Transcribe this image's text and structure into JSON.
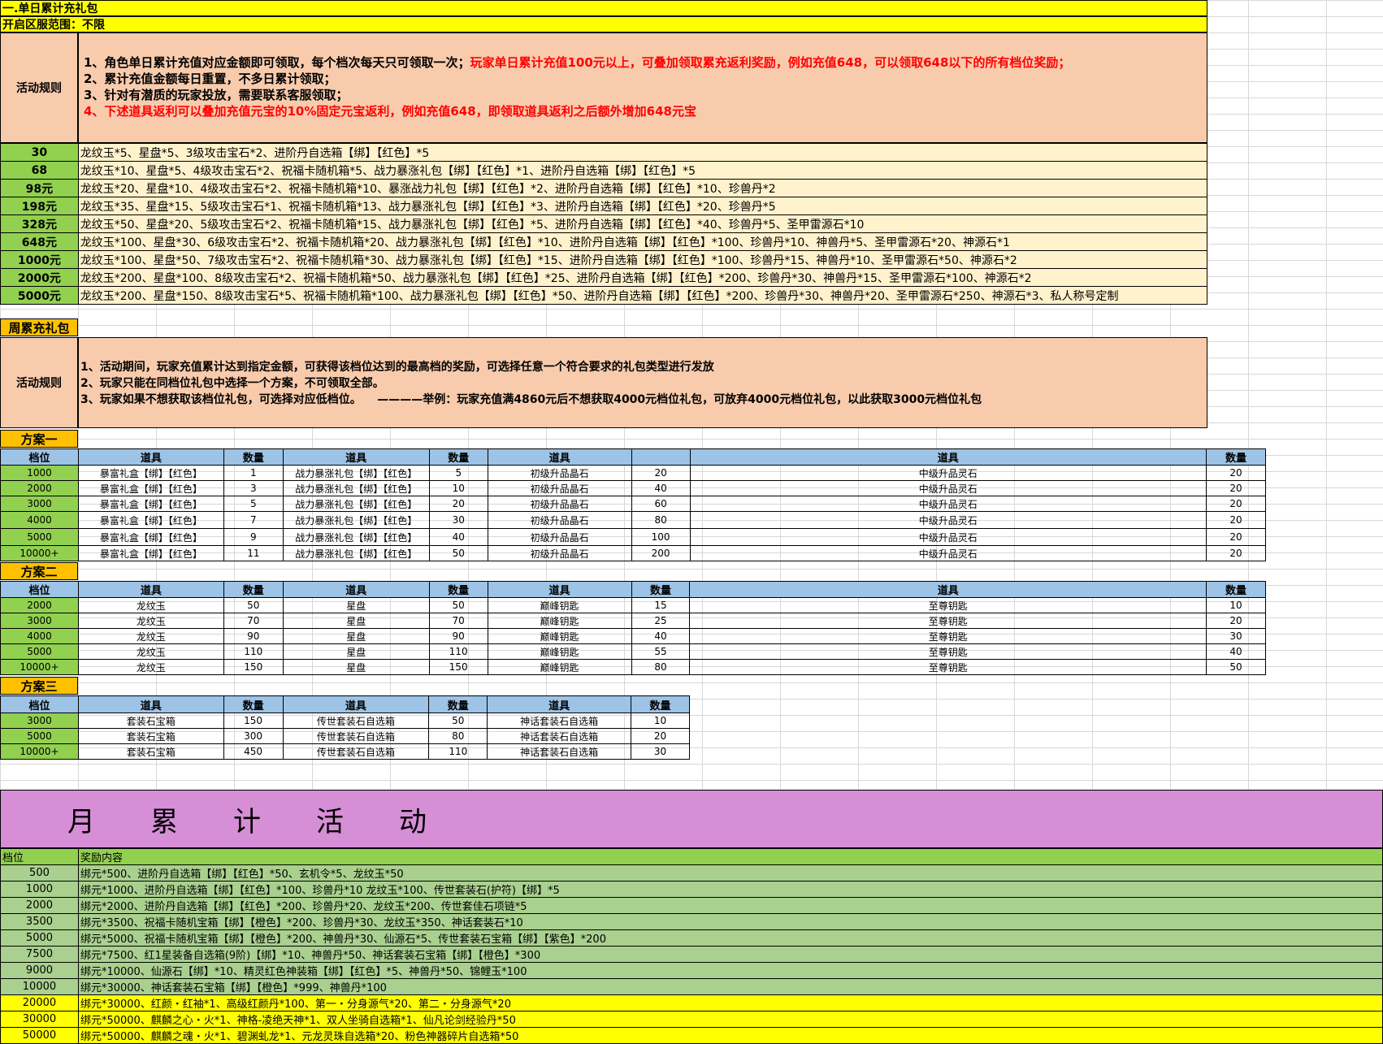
{
  "section1": {
    "title": "一.单日累计充礼包",
    "range": "开启区服范围：不限",
    "rules_label": "活动规则",
    "rules": [
      {
        "text": "1、角色单日累计充值对应金额即可领取，每个档次每天只可领取一次；",
        "red": "玩家单日累计充值100元以上，可叠加领取累充返利奖励，例如充值648，可以领取648以下的所有档位奖励；"
      },
      {
        "text": "2、累计充值金额每日重置，不多日累计领取；",
        "red": ""
      },
      {
        "text": "3、针对有潜质的玩家投放，需要联系客服领取；",
        "red": ""
      },
      {
        "text": "",
        "red": "4、下述道具返利可以叠加充值元宝的10%固定元宝返利，例如充值648，即领取道具返利之后额外增加648元宝"
      }
    ],
    "tiers": [
      {
        "level": "30",
        "reward": "龙纹玉*5、星盘*5、3级攻击宝石*2、进阶丹自选箱【绑】【红色】*5"
      },
      {
        "level": "68",
        "reward": "龙纹玉*10、星盘*5、4级攻击宝石*2、祝福卡随机箱*5、战力暴涨礼包【绑】【红色】*1、进阶丹自选箱【绑】【红色】*5"
      },
      {
        "level": "98元",
        "reward": "龙纹玉*20、星盘*10、4级攻击宝石*2、祝福卡随机箱*10、暴涨战力礼包【绑】【红色】*2、进阶丹自选箱【绑】【红色】*10、珍兽丹*2"
      },
      {
        "level": "198元",
        "reward": "龙纹玉*35、星盘*15、5级攻击宝石*1、祝福卡随机箱*13、战力暴涨礼包【绑】【红色】*3、进阶丹自选箱【绑】【红色】*20、珍兽丹*5"
      },
      {
        "level": "328元",
        "reward": "龙纹玉*50、星盘*20、5级攻击宝石*2、祝福卡随机箱*15、战力暴涨礼包【绑】【红色】*5、进阶丹自选箱【绑】【红色】*40、珍兽丹*5、圣甲雷源石*10"
      },
      {
        "level": "648元",
        "reward": "龙纹玉*100、星盘*30、6级攻击宝石*2、祝福卡随机箱*20、战力暴涨礼包【绑】【红色】*10、进阶丹自选箱【绑】【红色】*100、珍兽丹*10、神兽丹*5、圣甲雷源石*20、神源石*1"
      },
      {
        "level": "1000元",
        "reward": "龙纹玉*100、星盘*50、7级攻击宝石*2、祝福卡随机箱*30、战力暴涨礼包【绑】【红色】*15、进阶丹自选箱【绑】【红色】*100、珍兽丹*15、神兽丹*10、圣甲雷源石*50、神源石*2"
      },
      {
        "level": "2000元",
        "reward": "龙纹玉*200、星盘*100、8级攻击宝石*2、祝福卡随机箱*50、战力暴涨礼包【绑】【红色】*25、进阶丹自选箱【绑】【红色】*200、珍兽丹*30、神兽丹*15、圣甲雷源石*100、神源石*2"
      },
      {
        "level": "5000元",
        "reward": "龙纹玉*200、星盘*150、8级攻击宝石*5、祝福卡随机箱*100、战力暴涨礼包【绑】【红色】*50、进阶丹自选箱【绑】【红色】*200、珍兽丹*30、神兽丹*20、圣甲雷源石*250、神源石*3、私人称号定制"
      }
    ]
  },
  "section2": {
    "title": "周累充礼包",
    "rules_label": "活动规则",
    "rules": [
      "1、活动期间，玩家充值累计达到指定金额，可获得该档位达到的最高档的奖励，可选择任意一个符合要求的礼包类型进行发放",
      "2、玩家只能在同档位礼包中选择一个方案，不可领取全部。",
      "3、玩家如果不想获取该档位礼包，可选择对应低档位。    ————举例：玩家充值满4860元后不想获取4000元档位礼包，可放弃4000元档位礼包，以此获取3000元档位礼包"
    ],
    "plan1": {
      "title": "方案一",
      "headers": [
        "档位",
        "道具",
        "数量",
        "道具",
        "数量",
        "道具",
        "",
        "道具",
        "数量"
      ],
      "rows": [
        [
          "1000",
          "暴富礼盒【绑】【红色】",
          "1",
          "战力暴涨礼包【绑】【红色】",
          "5",
          "初级升品晶石",
          "20",
          "中级升品灵石",
          "20"
        ],
        [
          "2000",
          "暴富礼盒【绑】【红色】",
          "3",
          "战力暴涨礼包【绑】【红色】",
          "10",
          "初级升品晶石",
          "40",
          "中级升品灵石",
          "20"
        ],
        [
          "3000",
          "暴富礼盒【绑】【红色】",
          "5",
          "战力暴涨礼包【绑】【红色】",
          "20",
          "初级升品晶石",
          "60",
          "中级升品灵石",
          "20"
        ],
        [
          "4000",
          "暴富礼盒【绑】【红色】",
          "7",
          "战力暴涨礼包【绑】【红色】",
          "30",
          "初级升品晶石",
          "80",
          "中级升品灵石",
          "20"
        ],
        [
          "5000",
          "暴富礼盒【绑】【红色】",
          "9",
          "战力暴涨礼包【绑】【红色】",
          "40",
          "初级升品晶石",
          "100",
          "中级升品灵石",
          "20"
        ],
        [
          "10000+",
          "暴富礼盒【绑】【红色】",
          "11",
          "战力暴涨礼包【绑】【红色】",
          "50",
          "初级升品晶石",
          "200",
          "中级升品灵石",
          "20"
        ]
      ]
    },
    "plan2": {
      "title": "方案二",
      "headers": [
        "档位",
        "道具",
        "数量",
        "道具",
        "数量",
        "道具",
        "数量",
        "道具",
        "数量"
      ],
      "rows": [
        [
          "2000",
          "龙纹玉",
          "50",
          "星盘",
          "50",
          "巅峰钥匙",
          "15",
          "至尊钥匙",
          "10"
        ],
        [
          "3000",
          "龙纹玉",
          "70",
          "星盘",
          "70",
          "巅峰钥匙",
          "25",
          "至尊钥匙",
          "20"
        ],
        [
          "4000",
          "龙纹玉",
          "90",
          "星盘",
          "90",
          "巅峰钥匙",
          "40",
          "至尊钥匙",
          "30"
        ],
        [
          "5000",
          "龙纹玉",
          "110",
          "星盘",
          "110",
          "巅峰钥匙",
          "55",
          "至尊钥匙",
          "40"
        ],
        [
          "10000+",
          "龙纹玉",
          "150",
          "星盘",
          "150",
          "巅峰钥匙",
          "80",
          "至尊钥匙",
          "50"
        ]
      ]
    },
    "plan3": {
      "title": "方案三",
      "headers": [
        "档位",
        "道具",
        "数量",
        "道具",
        "数量",
        "道具",
        "数量"
      ],
      "rows": [
        [
          "3000",
          "套装石宝箱",
          "150",
          "传世套装石自选箱",
          "50",
          "神话套装石自选箱",
          "10"
        ],
        [
          "5000",
          "套装石宝箱",
          "300",
          "传世套装石自选箱",
          "80",
          "神话套装石自选箱",
          "20"
        ],
        [
          "10000+",
          "套装石宝箱",
          "450",
          "传世套装石自选箱",
          "110",
          "神话套装石自选箱",
          "30"
        ]
      ]
    }
  },
  "section3": {
    "title": "月　　累　　计　　活　　动",
    "headers": [
      "档位",
      "奖励内容"
    ],
    "rows": [
      {
        "level": "500",
        "reward": "绑元*500、进阶丹自选箱【绑】【红色】*50、玄机令*5、龙纹玉*50",
        "hl": false
      },
      {
        "level": "1000",
        "reward": "绑元*1000、进阶丹自选箱【绑】【红色】*100、珍兽丹*10 龙纹玉*100、传世套装石(护符)【绑】*5",
        "hl": false
      },
      {
        "level": "2000",
        "reward": "绑元*2000、进阶丹自选箱【绑】【红色】*200、珍兽丹*20、龙纹玉*200、传世套佳石项链*5",
        "hl": false
      },
      {
        "level": "3500",
        "reward": "绑元*3500、祝福卡随机宝箱【绑】【橙色】*200、珍兽丹*30、龙纹玉*350、神话套装石*10",
        "hl": false
      },
      {
        "level": "5000",
        "reward": "绑元*5000、祝福卡随机宝箱【绑】【橙色】*200、神兽丹*30、仙源石*5、传世套装石宝箱【绑】【紫色】*200",
        "hl": false
      },
      {
        "level": "7500",
        "reward": "绑元*7500、红1星装备自选箱(9阶)【绑】*10、神兽丹*50、神话套装石宝箱【绑】【橙色】*300",
        "hl": false
      },
      {
        "level": "9000",
        "reward": "绑元*10000、仙源石【绑】*10、精灵红色神装箱【绑】【红色】*5、神兽丹*50、锦鲤玉*100",
        "hl": false
      },
      {
        "level": "10000",
        "reward": "绑元*30000、神话套装石宝箱【绑】【橙色】*999、神兽丹*100",
        "hl": false
      },
      {
        "level": "20000",
        "reward": "绑元*30000、红颜・红袖*1、高级红颜丹*100、第一・分身源气*20、第二・分身源气*20",
        "hl": true
      },
      {
        "level": "30000",
        "reward": "绑元*50000、麒麟之心・火*1、神格-凌绝天神*1、双人坐骑自选箱*1、仙凡论剑经验丹*50",
        "hl": true
      },
      {
        "level": "50000",
        "reward": "绑元*50000、麒麟之魂・火*1、碧渊虬龙*1、元龙灵珠自选箱*20、粉色神器碎片自选箱*50",
        "hl": true
      }
    ]
  }
}
